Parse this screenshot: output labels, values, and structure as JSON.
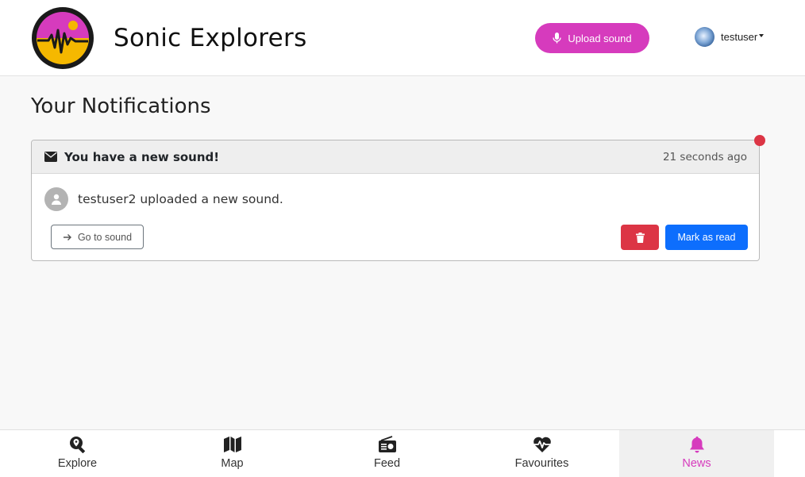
{
  "header": {
    "brand": "Sonic Explorers",
    "upload_label": "Upload sound",
    "username": "testuser"
  },
  "page_title": "Your Notifications",
  "notification": {
    "title": "You have a new sound!",
    "time": "21 seconds ago",
    "message": "testuser2 uploaded a new sound.",
    "go_label": "Go to sound",
    "mark_read_label": "Mark as read",
    "unread": true
  },
  "nav": {
    "items": [
      {
        "label": "Explore",
        "icon": "search-location-icon"
      },
      {
        "label": "Map",
        "icon": "map-icon"
      },
      {
        "label": "Feed",
        "icon": "radio-icon"
      },
      {
        "label": "Favourites",
        "icon": "heartbeat-icon"
      },
      {
        "label": "News",
        "icon": "bell-icon",
        "active": true
      }
    ]
  },
  "colors": {
    "brand_pink": "#d63bbd",
    "primary_blue": "#0d6efd",
    "danger_red": "#dc3545",
    "logo_yellow": "#f5b800"
  }
}
